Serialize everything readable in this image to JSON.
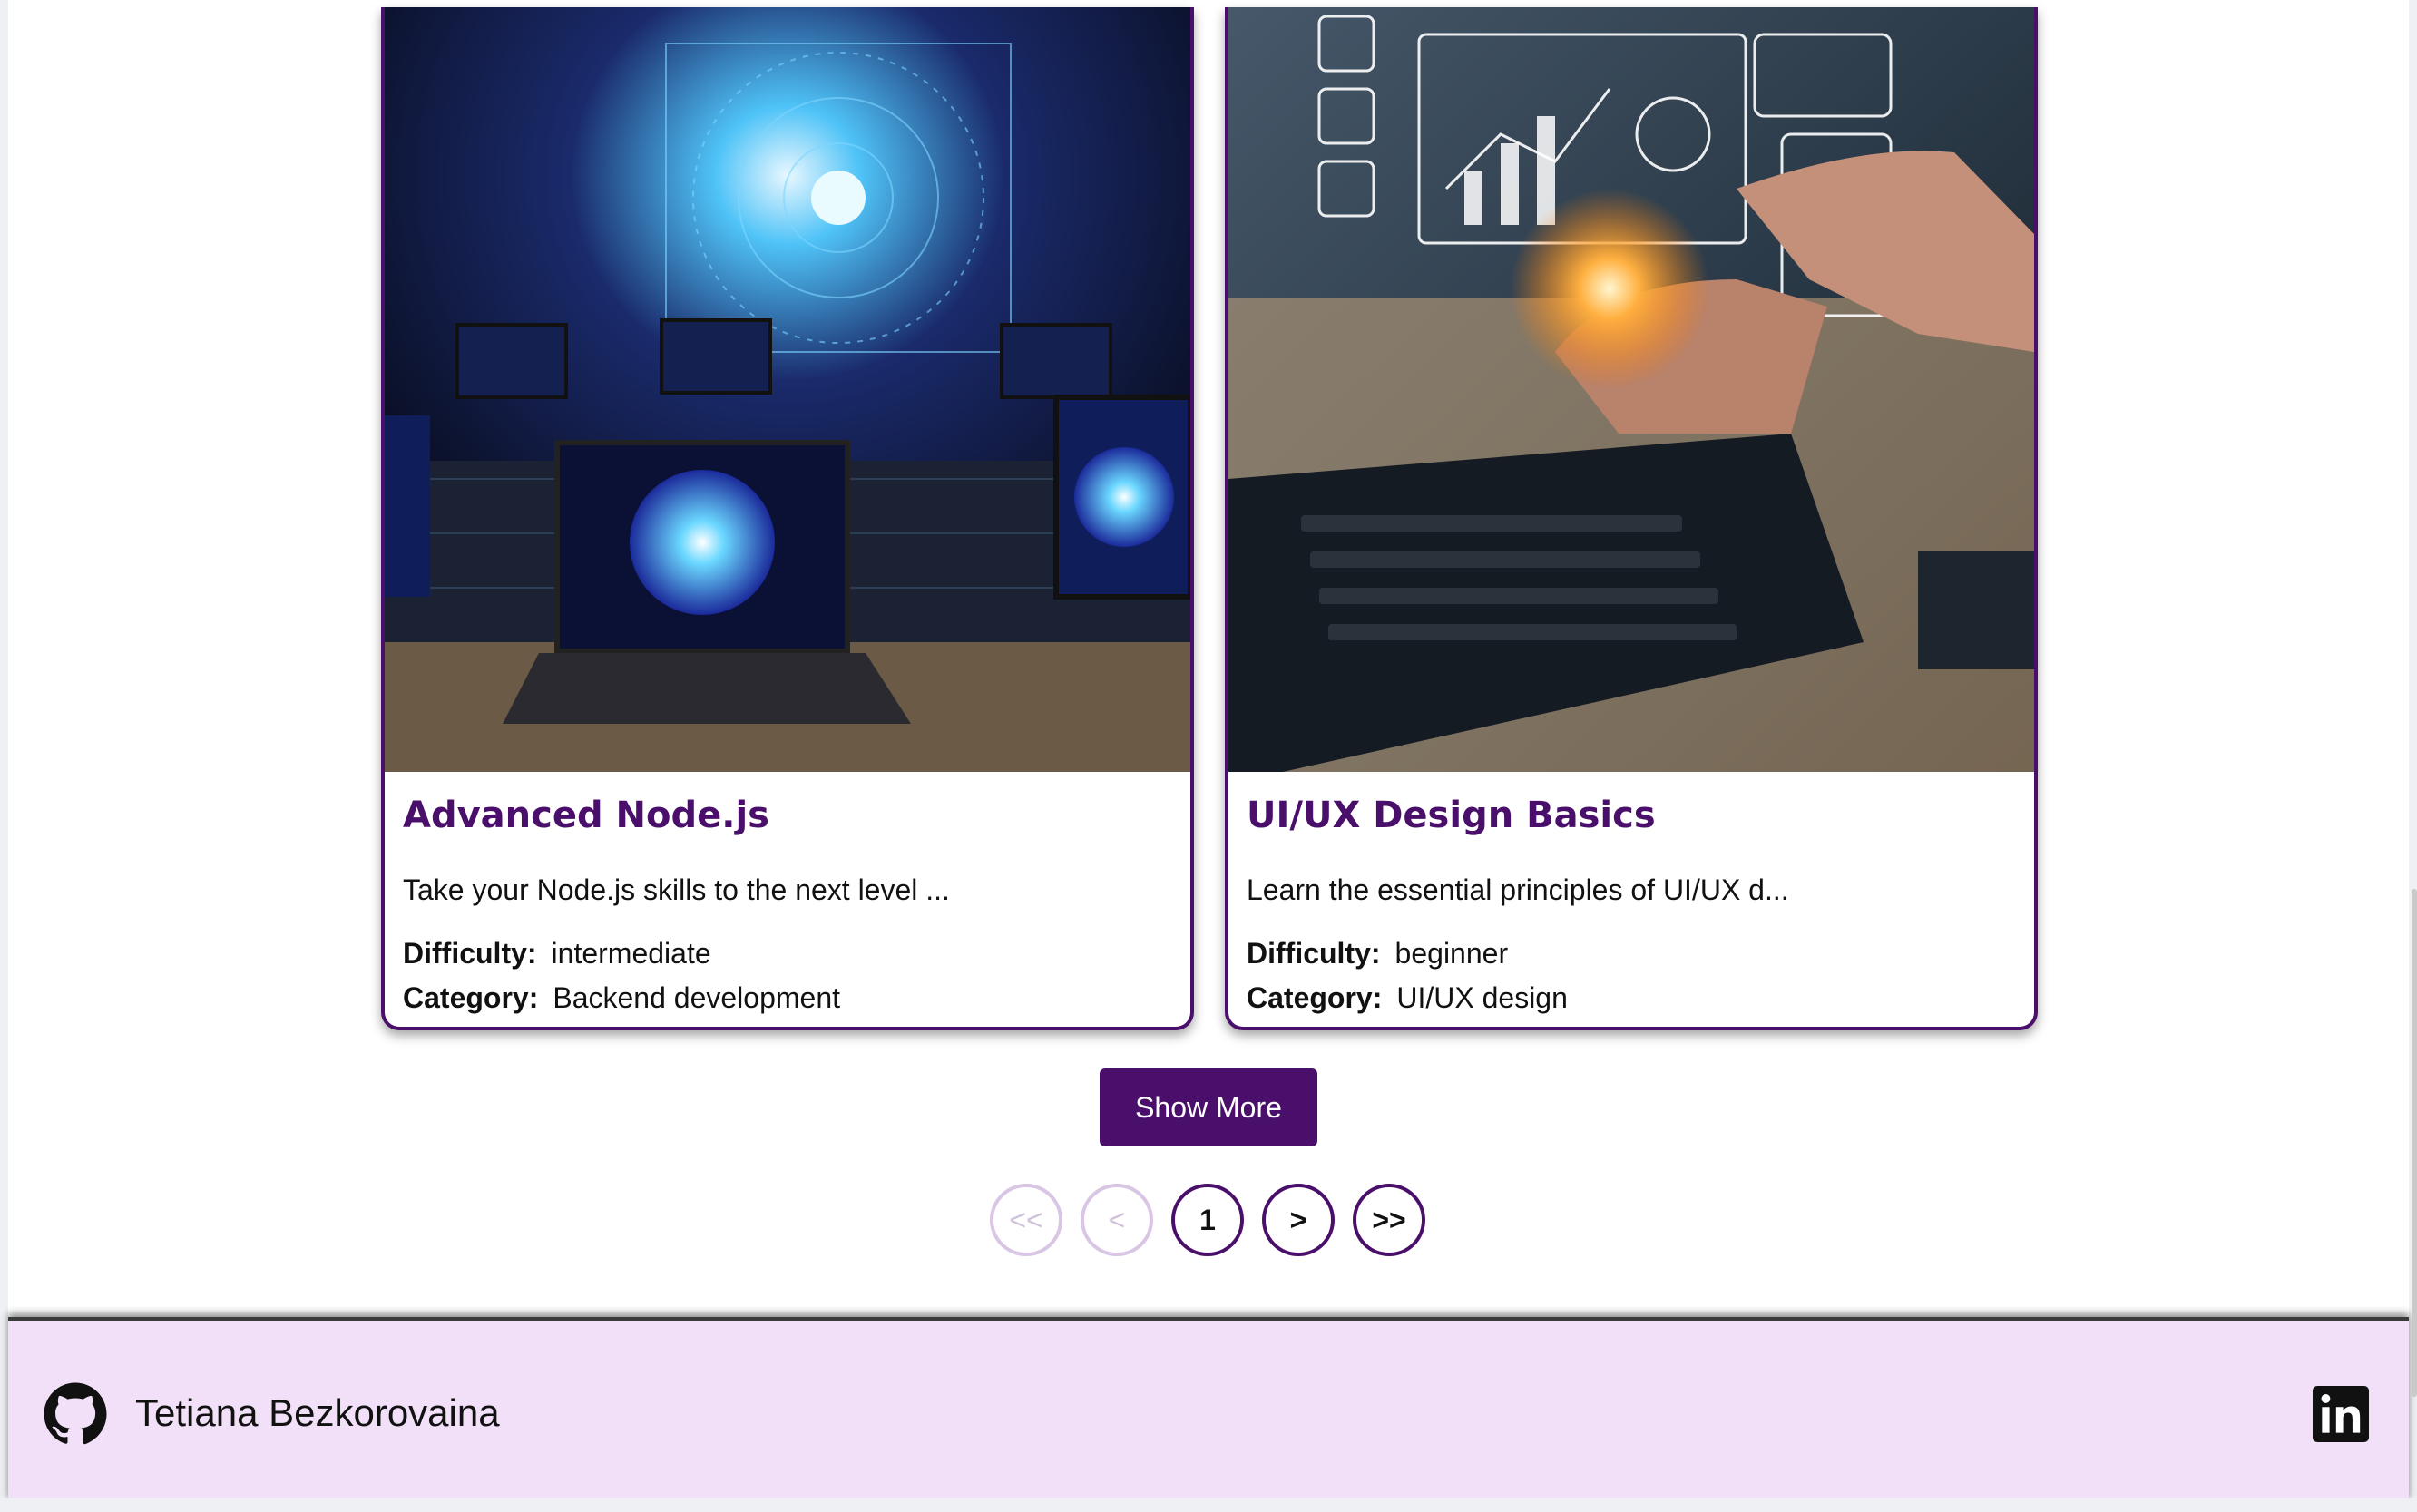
{
  "courses": [
    {
      "title": "Advanced Node.js",
      "description": "Take your Node.js skills to the next level ...",
      "difficulty_label": "Difficulty:",
      "difficulty": "intermediate",
      "category_label": "Category:",
      "category": "Backend development"
    },
    {
      "title": "UI/UX Design Basics",
      "description": "Learn the essential principles of UI/UX d...",
      "difficulty_label": "Difficulty:",
      "difficulty": "beginner",
      "category_label": "Category:",
      "category": "UI/UX design"
    }
  ],
  "show_more_label": "Show More",
  "pagination": {
    "first": "<<",
    "prev": "<",
    "current": "1",
    "next": ">",
    "last": ">>"
  },
  "footer": {
    "author": "Tetiana Bezkorovaina",
    "left_icon": "github-icon",
    "right_icon": "linkedin-icon"
  },
  "colors": {
    "accent": "#4a0f6a",
    "footer_bg": "#f1e0f8",
    "disabled": "#d8c6e4"
  }
}
